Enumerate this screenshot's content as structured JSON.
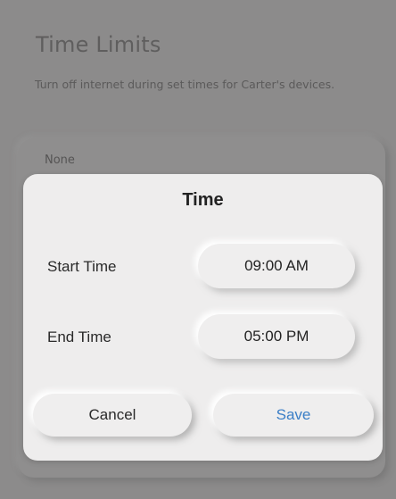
{
  "page": {
    "title": "Time Limits",
    "subtitle": "Turn off internet during set times for Carter's devices.",
    "selected_option": "None"
  },
  "dialog": {
    "title": "Time",
    "start_label": "Start Time",
    "start_value": "09:00 AM",
    "end_label": "End Time",
    "end_value": "05:00 PM",
    "cancel_label": "Cancel",
    "save_label": "Save"
  },
  "colors": {
    "overlay": "#8c8b8b",
    "dialog_bg": "#eeeded",
    "save_accent": "#3a7ec6"
  }
}
